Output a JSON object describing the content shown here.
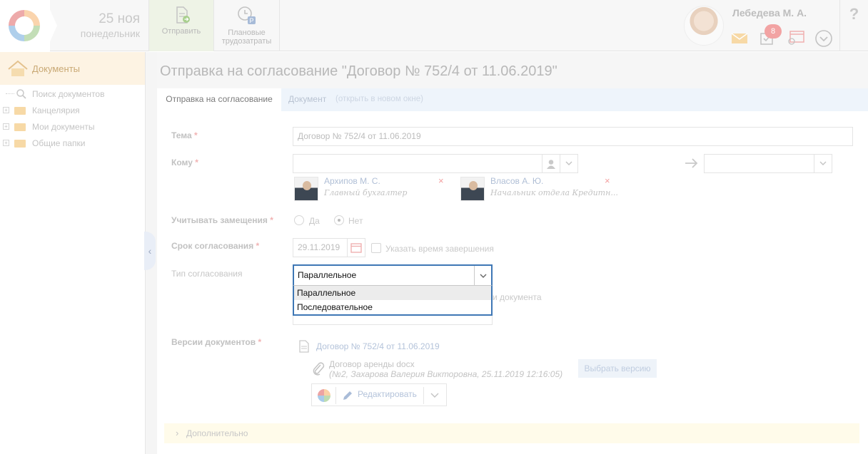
{
  "header": {
    "date_day": "25 ноя",
    "date_weekday": "понедельник",
    "send_label": "Отправить",
    "plan_label_1": "Плановые",
    "plan_label_2": "трудозатраты",
    "user_name": "Лебедева М. А.",
    "tasks_badge": "8",
    "help": "?"
  },
  "sidebar": {
    "title": "Документы",
    "items": [
      {
        "label": "Поиск документов"
      },
      {
        "label": "Канцелярия"
      },
      {
        "label": "Мои документы"
      },
      {
        "label": "Общие папки"
      }
    ]
  },
  "main": {
    "title": "Отправка на согласование \"Договор № 752/4 от 11.06.2019\"",
    "tabs": [
      {
        "label": "Отправка на согласование"
      },
      {
        "label": "Документ"
      },
      {
        "label": "(открыть в новом окне)"
      }
    ]
  },
  "form": {
    "subject_label": "Тема",
    "subject_value": "Договор № 752/4 от 11.06.2019",
    "to_label": "Кому",
    "required_mark": "*",
    "recipients": [
      {
        "name": "Архипов М. С.",
        "position": "Главный бухгалтер"
      },
      {
        "name": "Власов А. Ю.",
        "position": "Начальник отдела Кредитн..."
      }
    ],
    "remove_mark": "×",
    "substitutions_label": "Учитывать замещения",
    "opt_yes": "Да",
    "opt_no": "Нет",
    "deadline_label": "Срок согласования",
    "deadline_value": "29.11.2019",
    "specify_time_label": "Указать время завершения",
    "approval_type_label": "Тип согласования",
    "approval_type_value": "Параллельное",
    "approval_type_options": [
      "Параллельное",
      "Последовательное"
    ],
    "hidden_suffix": "и документа",
    "versions_label": "Версии документов",
    "doc_version": "Договор № 752/4 от 11.06.2019",
    "attachment_name": "Договор аренды docx",
    "attachment_meta": "(№2, Захарова Валерия Викторовна, 25.11.2019 12:16:05)",
    "choose_version": "Выбрать версию",
    "edit_label": "Редактировать",
    "additional_label": "Дополнительно"
  },
  "colors": {
    "focus_border": "#3e77b5",
    "badge": "#f2a3a3"
  }
}
